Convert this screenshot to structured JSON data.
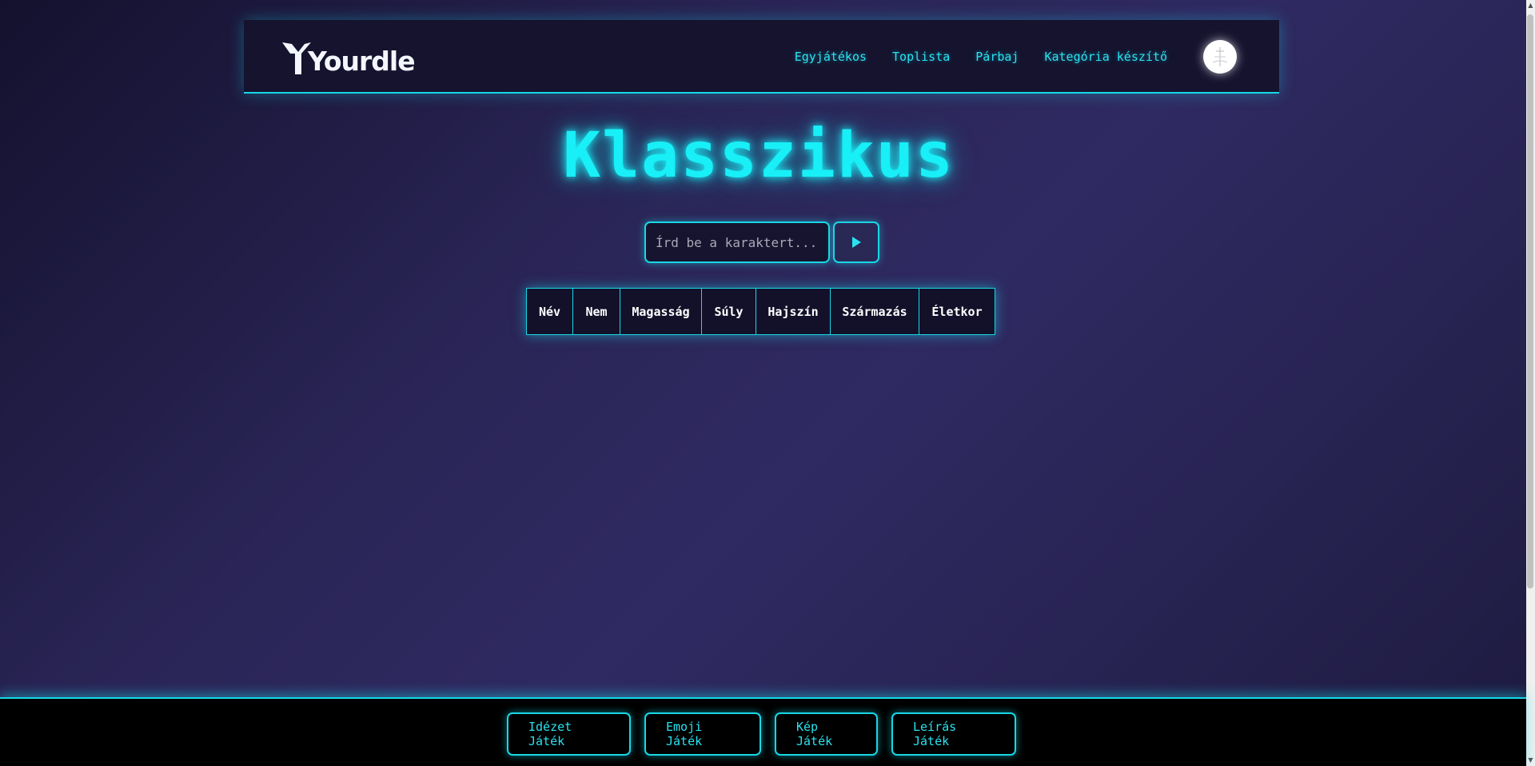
{
  "header": {
    "logo_text": "Yourdle",
    "nav": [
      {
        "label": "Egyjátékos"
      },
      {
        "label": "Toplista"
      },
      {
        "label": "Párbaj"
      },
      {
        "label": "Kategória készítő"
      }
    ]
  },
  "main": {
    "title": "Klasszikus",
    "search": {
      "placeholder": "Írd be a karaktert...",
      "value": ""
    },
    "columns": [
      "Név",
      "Nem",
      "Magasság",
      "Súly",
      "Hajszín",
      "Származás",
      "Életkor"
    ]
  },
  "footer": {
    "buttons": [
      {
        "label": "Idézet Játék"
      },
      {
        "label": "Emoji Játék"
      },
      {
        "label": "Kép Játék"
      },
      {
        "label": "Leírás Játék"
      }
    ]
  },
  "colors": {
    "accent": "#18d7e6",
    "title": "#18eff7",
    "header_bg": "#15132e",
    "footer_bg": "#000000"
  },
  "icons": {
    "submit": "play-icon",
    "avatar": "user-avatar-icon",
    "logo": "yourdle-logo-icon"
  }
}
